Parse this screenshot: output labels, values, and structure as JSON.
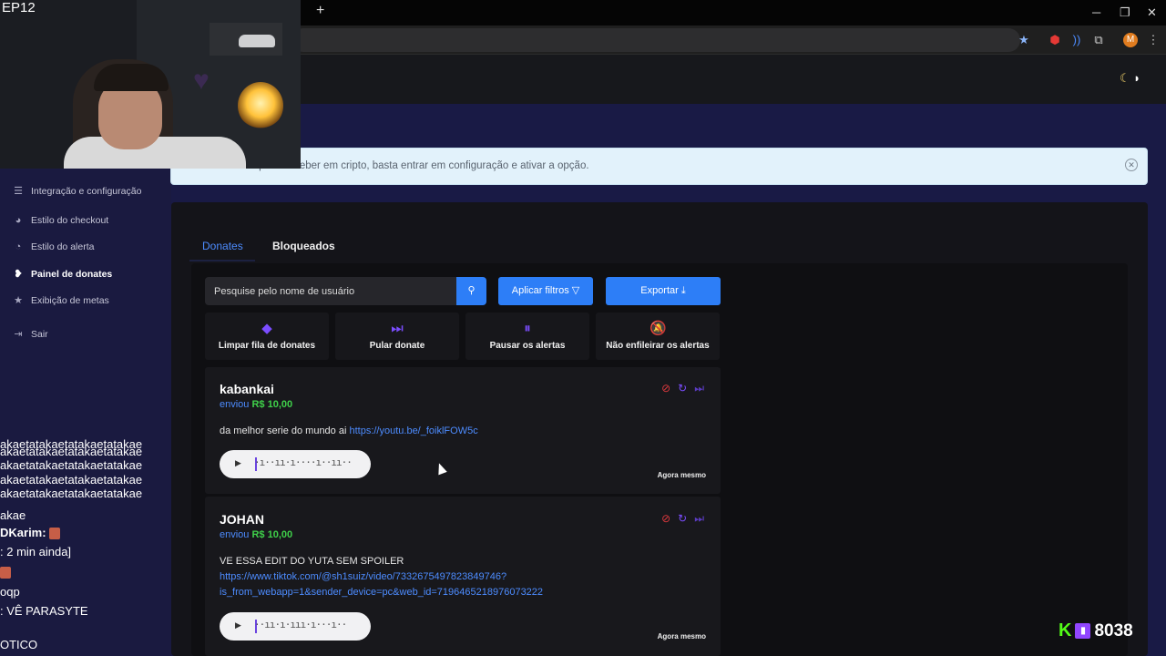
{
  "browser": {
    "new_tab_icon": "plus-icon",
    "chevron_icon": "chevron-left-icon",
    "window_controls": [
      "─",
      "❐",
      "✕"
    ],
    "toolbar_icons": [
      "star-icon",
      "record-icon",
      "cast-icon",
      "extensions-icon"
    ],
    "avatar_initial": "M",
    "menu": "⋮"
  },
  "stream": {
    "episode": "EP12",
    "viewer_count": "8038",
    "viewer_k": "K",
    "chat_lines": [
      "akaetatakaetatakaetatakae",
      "akaetatakaetatakaetatakae",
      "akaetatakaetatakaetatakae",
      "akaetatakaetatakaetatakae",
      "akaetatakaetatakaetatakae",
      "akae",
      "DKarim:",
      ": 2 min ainda]",
      "",
      "oqp",
      ": VÊ PARASYTE",
      "",
      "OTICO"
    ]
  },
  "theme_toggle": {
    "sun": "☾",
    "moon": "◗"
  },
  "sidebar": {
    "items": [
      {
        "label": "Integração e configuração",
        "icon": "document-icon",
        "glyph": "☰"
      },
      {
        "label": "Estilo do checkout",
        "icon": "palette-icon",
        "glyph": "◕"
      },
      {
        "label": "Estilo do alerta",
        "icon": "palette-icon",
        "glyph": "◔"
      },
      {
        "label": "Painel de donates",
        "icon": "hand-coin-icon",
        "glyph": "❥"
      },
      {
        "label": "Exibição de metas",
        "icon": "star-icon",
        "glyph": "★"
      },
      {
        "label": "Sair",
        "icon": "logout-icon",
        "glyph": "⇥"
      }
    ]
  },
  "alert": {
    "text": "Agora você também pode receber em cripto, basta entrar em configuração e ativar a opção.",
    "visible_text": "cê também pode receber em cripto, basta entrar em configuração e ativar a opção."
  },
  "tabs": {
    "donates": "Donates",
    "bloqueados": "Bloqueados"
  },
  "search": {
    "placeholder": "Pesquise pelo nome de usuário"
  },
  "buttons": {
    "apply_filters": "Aplicar filtros",
    "export": "Exportar"
  },
  "actions": [
    {
      "label": "Limpar fila de donates",
      "icon": "eraser-icon",
      "glyph": "◆"
    },
    {
      "label": "Pular donate",
      "icon": "skip-icon",
      "glyph": "⏭"
    },
    {
      "label": "Pausar os alertas",
      "icon": "pause-icon",
      "glyph": "⏸"
    },
    {
      "label": "Não enfileirar os alertas",
      "icon": "bell-off-icon",
      "glyph": "🔕"
    }
  ],
  "donations": [
    {
      "user": "kabankai",
      "sent_label": "enviou",
      "amount": "R$ 10,00",
      "message": "da melhor serie do mundo ai ",
      "link": "https://youtu.be/_foiklFOW5c",
      "time": "Agora mesmo"
    },
    {
      "user": "JOHAN",
      "sent_label": "enviou",
      "amount": "R$ 10,00",
      "message": "VE ESSA EDIT DO YUTA SEM SPOILER",
      "link_line1": "https://www.tiktok.com/@sh1suiz/video/7332675497823849746?",
      "link_line2": "is_from_webapp=1&sender_device=pc&web_id=7196465218976073222",
      "time": "Agora mesmo"
    }
  ]
}
